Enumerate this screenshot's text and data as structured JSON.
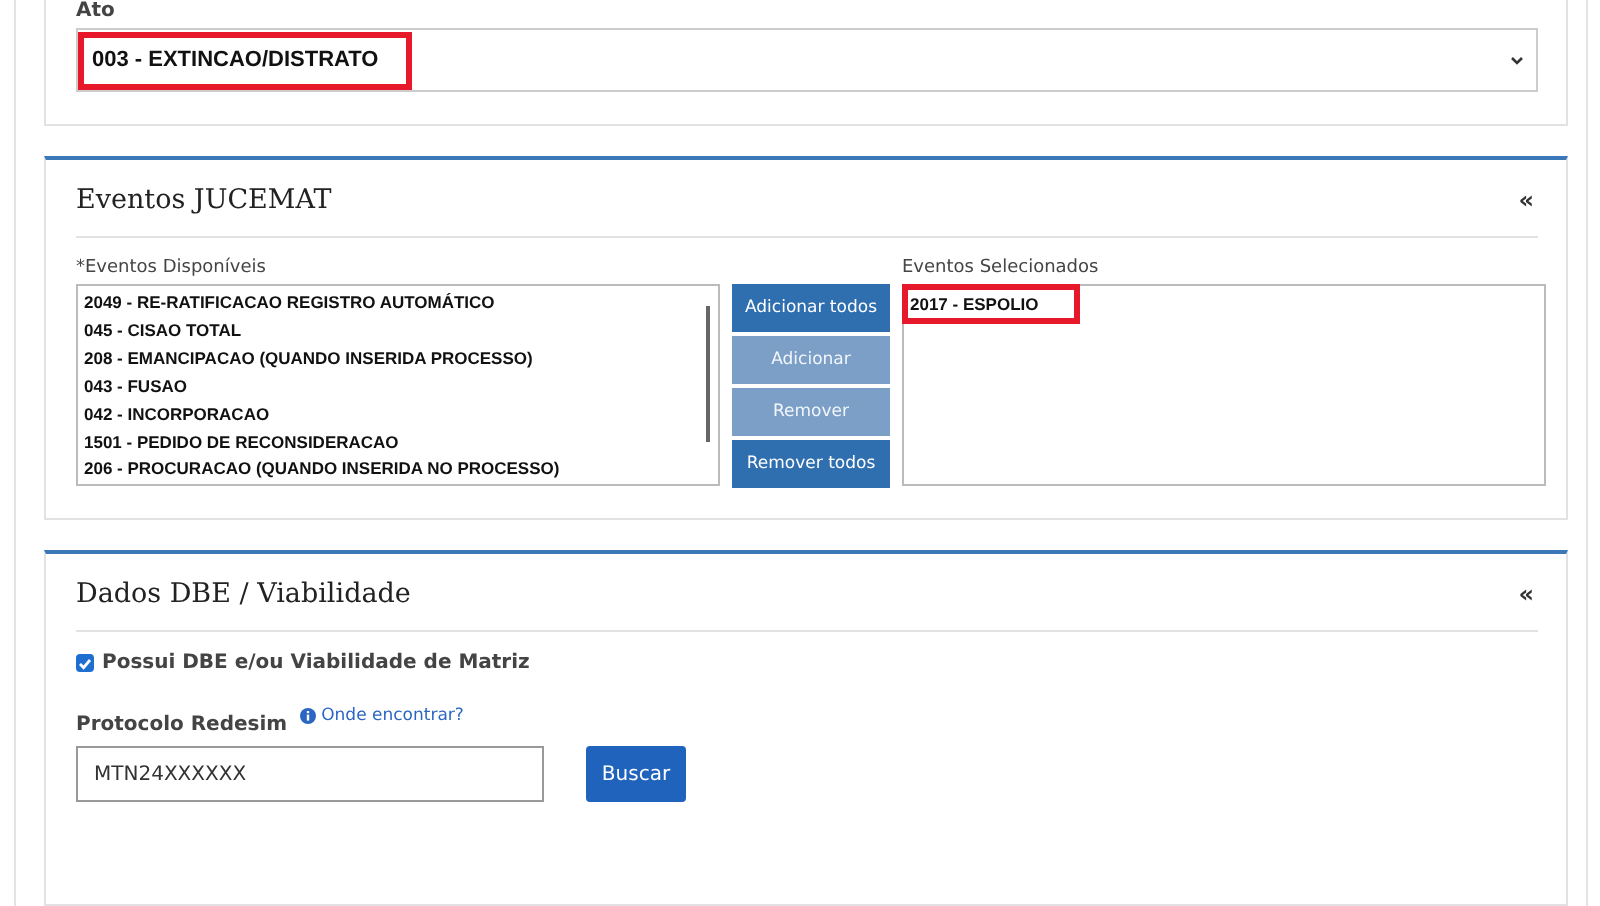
{
  "ato": {
    "label": "Ato",
    "value": "003 - EXTINCAO/DISTRATO",
    "highlighted": true
  },
  "eventos": {
    "title": "Eventos JUCEMAT",
    "collapse": "«",
    "available_label": "*Eventos Disponíveis",
    "selected_label": "Eventos Selecionados",
    "available": [
      {
        "text": "2049 - RE-RATIFICACAO REGISTRO AUTOMÁTICO",
        "highlighted": false
      },
      {
        "text": "045 - CISAO TOTAL",
        "highlighted": false
      },
      {
        "text": "208 - EMANCIPACAO (QUANDO INSERIDA PROCESSO)",
        "highlighted": false
      },
      {
        "text": "043 - FUSAO",
        "highlighted": false
      },
      {
        "text": "042 - INCORPORACAO",
        "highlighted": false
      },
      {
        "text": "1501 - PEDIDO DE RECONSIDERACAO",
        "highlighted": false
      },
      {
        "text": "206 - PROCURACAO (QUANDO INSERIDA NO PROCESSO)",
        "highlighted": false
      }
    ],
    "buttons": [
      {
        "label": "Adicionar todos",
        "disabled": false
      },
      {
        "label": "Adicionar",
        "disabled": true
      },
      {
        "label": "Remover",
        "disabled": true
      },
      {
        "label": "Remover todos",
        "disabled": false
      }
    ],
    "selected": [
      {
        "text": "2017 - ESPOLIO",
        "highlighted": true
      }
    ]
  },
  "dbe": {
    "title": "Dados DBE / Viabilidade",
    "collapse": "«",
    "checkbox": {
      "label": "Possui DBE e/ou Viabilidade de Matriz",
      "checked": true
    },
    "protocolo_label": "Protocolo Redesim",
    "help_link": "Onde encontrar?",
    "protocolo_value": "MTN24XXXXXX",
    "search_button": "Buscar"
  }
}
